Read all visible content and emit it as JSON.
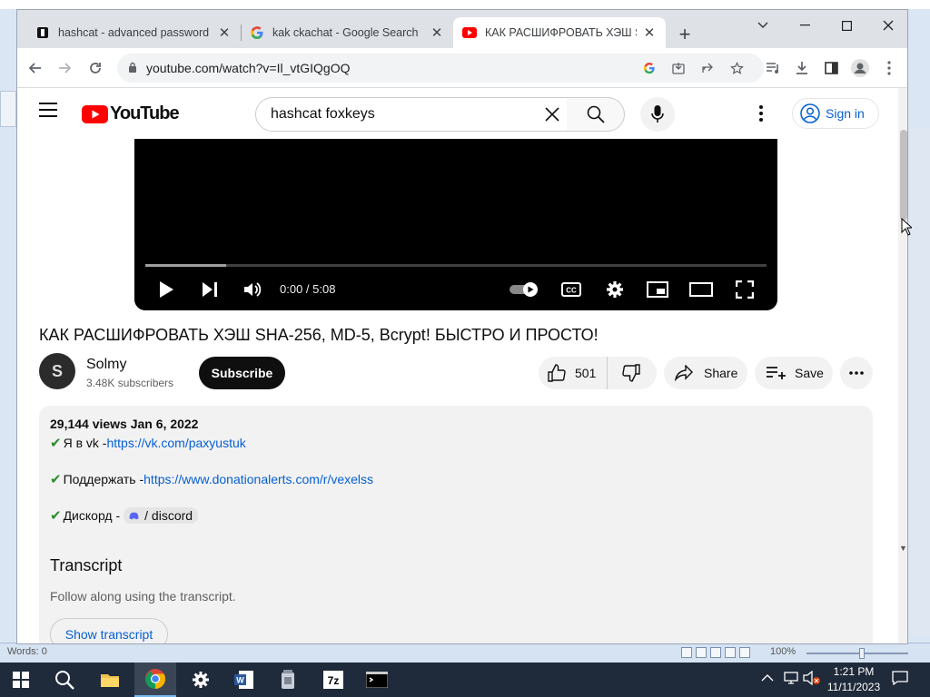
{
  "background_app": {
    "status_words": "Words: 0",
    "zoom": "100%"
  },
  "browser": {
    "tabs": [
      {
        "title": "hashcat - advanced password r",
        "icon": "hashcat-favicon",
        "active": false
      },
      {
        "title": "kak ckachat - Google Search",
        "icon": "google-favicon",
        "active": false
      },
      {
        "title": "КАК РАСШИФРОВАТЬ ХЭШ SHA",
        "icon": "youtube-favicon",
        "active": true
      }
    ],
    "url": "youtube.com/watch?v=Il_vtGIQgOQ"
  },
  "youtube": {
    "logo_text": "YouTube",
    "search_value": "hashcat foxkeys",
    "sign_in": "Sign in",
    "player": {
      "time": "0:00 / 5:08",
      "buffered": 0.13
    },
    "video_title": "КАК РАСШИФРОВАТЬ ХЭШ SHA-256, MD-5, Bcrypt! БЫСТРО И ПРОСТО!",
    "channel": {
      "initial": "S",
      "name": "Solmy",
      "subscribers": "3.48K subscribers"
    },
    "subscribe": "Subscribe",
    "likes": "501",
    "share": "Share",
    "save": "Save",
    "description": {
      "meta": "29,144 views  Jan 6, 2022",
      "lines": [
        {
          "label": "Я в vk - ",
          "link": "https://vk.com/paxyustuk"
        },
        {
          "label": "Поддержать - ",
          "link": "https://www.donationalerts.com/r/vexelss"
        },
        {
          "label": "Дискорд - ",
          "chip": "/ discord"
        }
      ],
      "transcript_heading": "Transcript",
      "transcript_sub": "Follow along using the transcript.",
      "transcript_button": "Show transcript"
    }
  },
  "taskbar": {
    "time": "1:21 PM",
    "date": "11/11/2023"
  }
}
